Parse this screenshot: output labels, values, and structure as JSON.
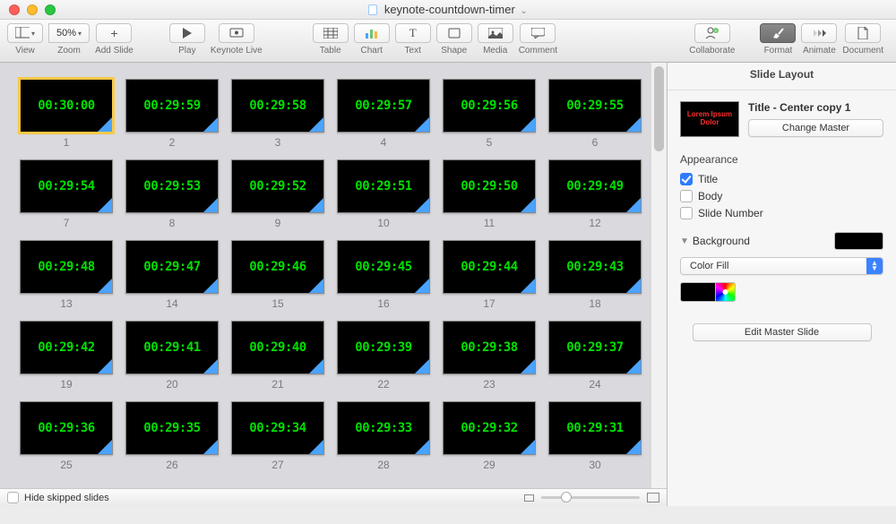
{
  "window": {
    "title": "keynote-countdown-timer"
  },
  "toolbar": {
    "view": "View",
    "zoom_value": "50%",
    "zoom": "Zoom",
    "add_slide": "Add Slide",
    "play": "Play",
    "keynote_live": "Keynote Live",
    "table": "Table",
    "chart": "Chart",
    "text": "Text",
    "shape": "Shape",
    "media": "Media",
    "comment": "Comment",
    "collaborate": "Collaborate",
    "format": "Format",
    "animate": "Animate",
    "document": "Document"
  },
  "slides": [
    {
      "n": "1",
      "t": "00:30:00",
      "sel": true
    },
    {
      "n": "2",
      "t": "00:29:59"
    },
    {
      "n": "3",
      "t": "00:29:58"
    },
    {
      "n": "4",
      "t": "00:29:57"
    },
    {
      "n": "5",
      "t": "00:29:56"
    },
    {
      "n": "6",
      "t": "00:29:55"
    },
    {
      "n": "7",
      "t": "00:29:54"
    },
    {
      "n": "8",
      "t": "00:29:53"
    },
    {
      "n": "9",
      "t": "00:29:52"
    },
    {
      "n": "10",
      "t": "00:29:51"
    },
    {
      "n": "11",
      "t": "00:29:50"
    },
    {
      "n": "12",
      "t": "00:29:49"
    },
    {
      "n": "13",
      "t": "00:29:48"
    },
    {
      "n": "14",
      "t": "00:29:47"
    },
    {
      "n": "15",
      "t": "00:29:46"
    },
    {
      "n": "16",
      "t": "00:29:45"
    },
    {
      "n": "17",
      "t": "00:29:44"
    },
    {
      "n": "18",
      "t": "00:29:43"
    },
    {
      "n": "19",
      "t": "00:29:42"
    },
    {
      "n": "20",
      "t": "00:29:41"
    },
    {
      "n": "21",
      "t": "00:29:40"
    },
    {
      "n": "22",
      "t": "00:29:39"
    },
    {
      "n": "23",
      "t": "00:29:38"
    },
    {
      "n": "24",
      "t": "00:29:37"
    },
    {
      "n": "25",
      "t": "00:29:36"
    },
    {
      "n": "26",
      "t": "00:29:35"
    },
    {
      "n": "27",
      "t": "00:29:34"
    },
    {
      "n": "28",
      "t": "00:29:33"
    },
    {
      "n": "29",
      "t": "00:29:32"
    },
    {
      "n": "30",
      "t": "00:29:31"
    }
  ],
  "footer": {
    "hide_skipped": "Hide skipped slides"
  },
  "inspector": {
    "panel_title": "Slide Layout",
    "master_thumb_text": "Lorem Ipsum Dolor",
    "master_name": "Title - Center copy 1",
    "change_master": "Change Master",
    "appearance": "Appearance",
    "cb_title": "Title",
    "cb_body": "Body",
    "cb_slidenum": "Slide Number",
    "background": "Background",
    "fill_mode": "Color Fill",
    "edit_master": "Edit Master Slide"
  }
}
